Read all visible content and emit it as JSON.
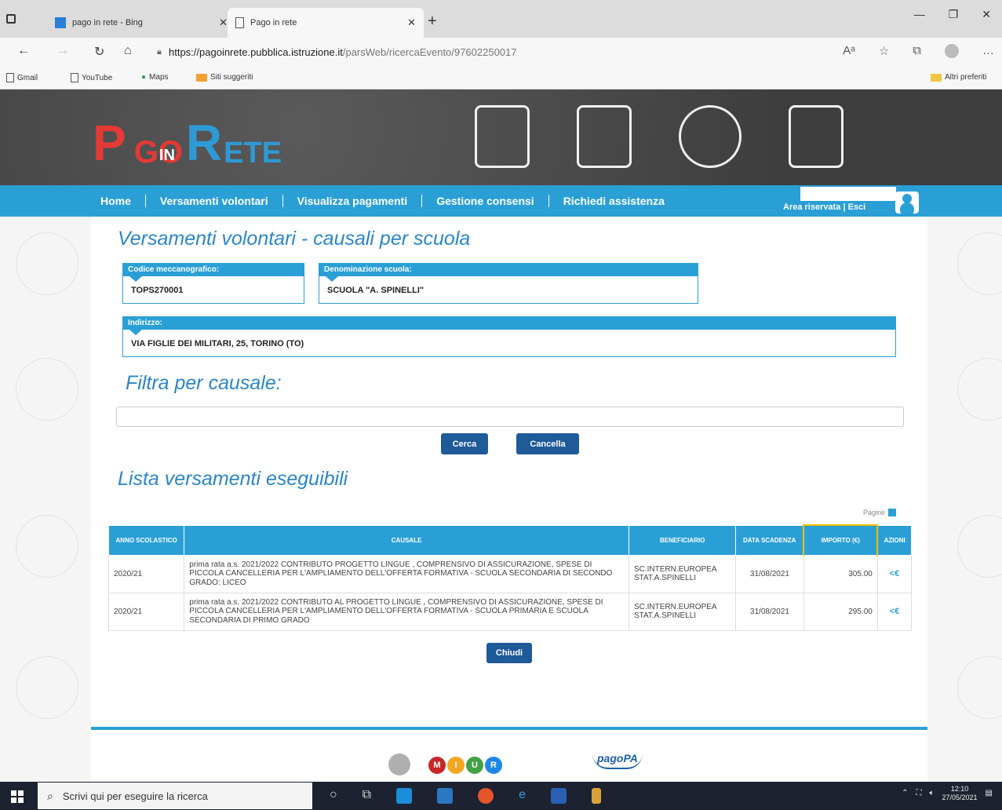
{
  "browser": {
    "tabs": [
      {
        "label": "pago in rete - Bing"
      },
      {
        "label": "Pago in rete"
      }
    ],
    "url_host": "https://pagoinrete.pubblica.istruzione.it",
    "url_path": "/parsWeb/ricercaEvento/97602250017",
    "bookmarks": [
      "Gmail",
      "YouTube",
      "Maps",
      "Siti suggeriti"
    ],
    "other_bookmarks": "Altri preferiti"
  },
  "logo": {
    "p": "P",
    "go": "GO",
    "in": "IN",
    "r": "R",
    "ete": "ETE"
  },
  "menu": [
    "Home",
    "Versamenti volontari",
    "Visualizza pagamenti",
    "Gestione consensi",
    "Richiedi assistenza"
  ],
  "area": "Area riservata | Esci",
  "page": {
    "title": "Versamenti volontari - causali per scuola",
    "codice_label": "Codice meccanografico:",
    "codice_value": "TOPS270001",
    "denominazione_label": "Denominazione scuola:",
    "denominazione_value": "SCUOLA \"A. SPINELLI\"",
    "indirizzo_label": "Indirizzo:",
    "indirizzo_value": "VIA FIGLIE DEI MILITARI, 25, TORINO (TO)",
    "filter_title": "Filtra per causale:",
    "cerca": "Cerca",
    "cancella": "Cancella",
    "list_title": "Lista versamenti eseguibili",
    "pagine": "Pagine",
    "pagine_num": "1",
    "chiudi": "Chiudi"
  },
  "table": {
    "headers": [
      "ANNO SCOLASTICO",
      "CAUSALE",
      "BENEFICIARIO",
      "DATA SCADENZA",
      "IMPORTO (€)",
      "AZIONI"
    ],
    "rows": [
      {
        "anno": "2020/21",
        "causale": "prima rata a.s. 2021/2022 CONTRIBUTO PROGETTO LINGUE , COMPRENSIVO DI ASSICURAZIONE, SPESE DI PICCOLA CANCELLERIA PER L'AMPLIAMENTO DELL'OFFERTA FORMATIVA - SCUOLA SECONDARIA DI SECONDO GRADO: LICEO",
        "beneficiario": "SC.INTERN.EUROPEA STAT.A.SPINELLI",
        "scadenza": "31/08/2021",
        "importo": "305.00",
        "azione": "<€"
      },
      {
        "anno": "2020/21",
        "causale": "prima rata a.s. 2021/2022 CONTRIBUTO AL PROGETTO LINGUE , COMPRENSIVO DI ASSICURAZIONE, SPESE DI PICCOLA CANCELLERIA PER L'AMPLIAMENTO DELL'OFFERTA FORMATIVA - SCUOLA PRIMARIA E SCUOLA SECONDARIA DI PRIMO GRADO",
        "beneficiario": "SC.INTERN.EUROPEA STAT.A.SPINELLI",
        "scadenza": "31/08/2021",
        "importo": "295.00",
        "azione": "<€"
      }
    ]
  },
  "footer": {
    "miur": [
      "M",
      "I",
      "U",
      "R"
    ],
    "pagopa": "pagoPA"
  },
  "taskbar": {
    "search_placeholder": "Scrivi qui per eseguire la ricerca",
    "time": "12:10",
    "date": "27/05/2021"
  },
  "colors": {
    "primary": "#2a9fd6",
    "button": "#1f5a99",
    "title": "#2a86c8",
    "logo_red": "#e53935"
  }
}
